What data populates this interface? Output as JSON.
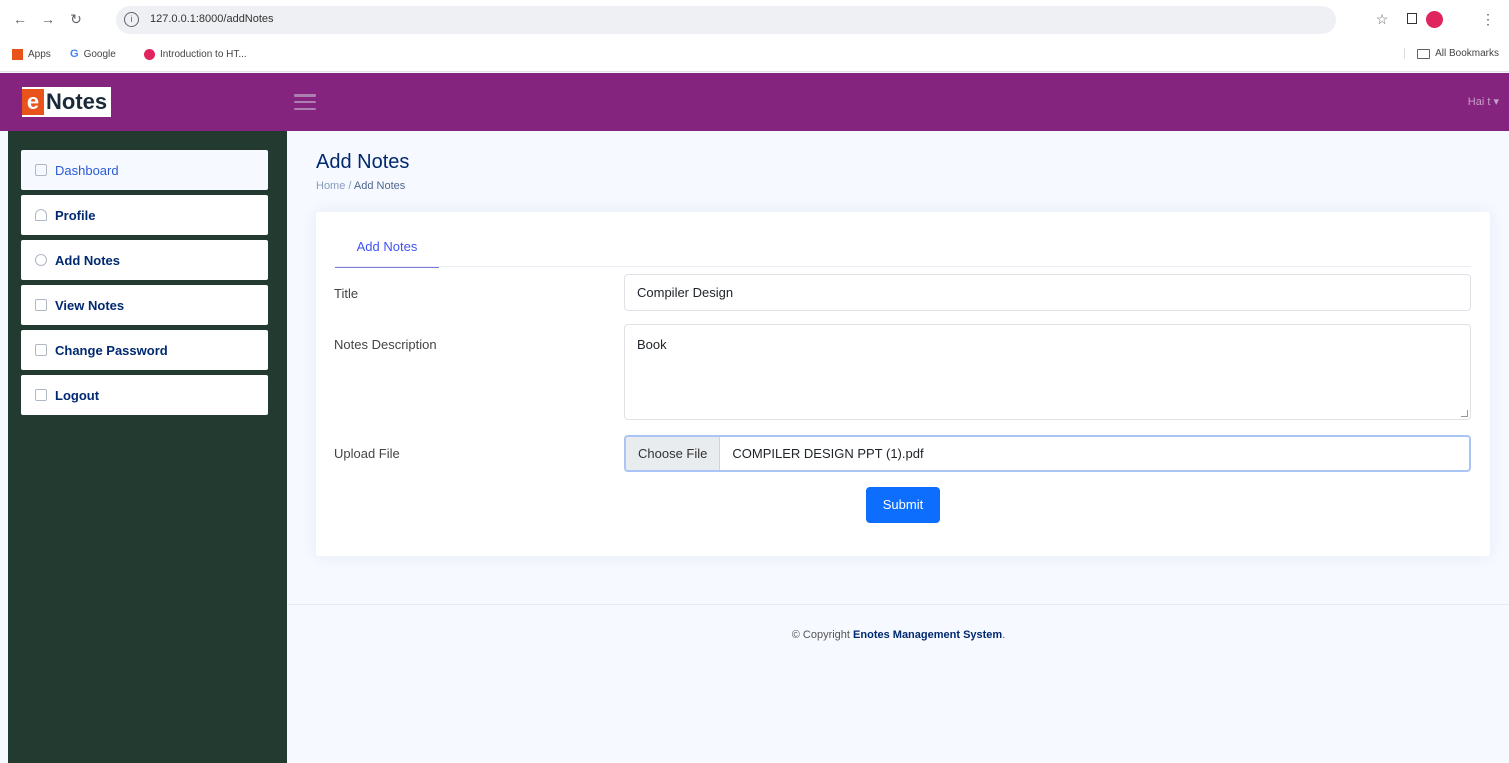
{
  "browser": {
    "back": "←",
    "forward": "→",
    "reload": "↻",
    "url": "127.0.0.1:8000/addNotes",
    "lock": "i",
    "star": "☆",
    "bookmarks": [
      {
        "label": "Apps",
        "color": "#e8531c"
      },
      {
        "label": "Google",
        "color": "#4285f4"
      },
      {
        "label": "Introduction to HT...",
        "color": "#e0245e"
      }
    ],
    "all_bookmarks": "All Bookmarks"
  },
  "header": {
    "logo_e": "e",
    "logo_text": "Notes",
    "user_label": "Hai t ▾"
  },
  "sidebar": {
    "items": [
      {
        "label": "Dashboard",
        "icon": "grid-icon"
      },
      {
        "label": "Profile",
        "icon": "person-icon"
      },
      {
        "label": "Add Notes",
        "icon": "question-circle-icon"
      },
      {
        "label": "View Notes",
        "icon": "layout-icon"
      },
      {
        "label": "Change Password",
        "icon": "list-icon"
      },
      {
        "label": "Logout",
        "icon": "box-arrow-icon"
      }
    ]
  },
  "main": {
    "title": "Add Notes",
    "breadcrumb": {
      "home": "Home",
      "sep": "/",
      "current": "Add Notes"
    },
    "tab": "Add Notes",
    "form": {
      "title_label": "Title",
      "title_value": "Compiler Design",
      "desc_label": "Notes Description",
      "desc_value": "Book",
      "file_label": "Upload File",
      "file_button": "Choose File",
      "file_name": "COMPILER DESIGN PPT (1).pdf",
      "submit": "Submit"
    }
  },
  "footer": {
    "prefix": "© Copyright",
    "brand": "Enotes Management System",
    "suffix": "."
  },
  "colors": {
    "header": "#84247f",
    "sidebar": "#223a2f",
    "primary": "#0d6efd"
  }
}
